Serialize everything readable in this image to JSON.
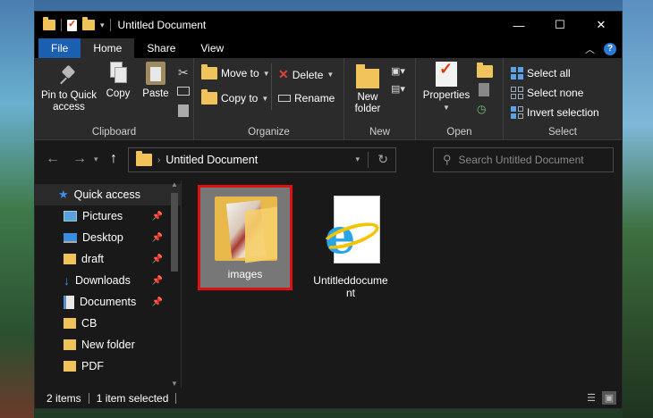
{
  "window": {
    "title": "Untitled Document"
  },
  "controls": {
    "minimize": "—",
    "maximize": "☐",
    "close": "✕"
  },
  "tabs": [
    {
      "label": "File"
    },
    {
      "label": "Home"
    },
    {
      "label": "Share"
    },
    {
      "label": "View"
    }
  ],
  "ribbon": {
    "clipboard": {
      "label": "Clipboard",
      "pin": "Pin to Quick access",
      "copy": "Copy",
      "paste": "Paste"
    },
    "organize": {
      "label": "Organize",
      "move_to": "Move to",
      "copy_to": "Copy to",
      "delete": "Delete",
      "rename": "Rename"
    },
    "new": {
      "label": "New",
      "new_folder": "New folder"
    },
    "open": {
      "label": "Open",
      "properties": "Properties"
    },
    "select": {
      "label": "Select",
      "select_all": "Select all",
      "select_none": "Select none",
      "invert": "Invert selection"
    }
  },
  "address": {
    "path": "Untitled Document",
    "search_placeholder": "Search Untitled Document"
  },
  "sidebar": {
    "items": [
      {
        "label": "Quick access",
        "icon": "star-icon",
        "pinned": false
      },
      {
        "label": "Pictures",
        "icon": "pictures-icon",
        "pinned": true
      },
      {
        "label": "Desktop",
        "icon": "desktop-icon",
        "pinned": true
      },
      {
        "label": "draft",
        "icon": "folder-icon",
        "pinned": true
      },
      {
        "label": "Downloads",
        "icon": "download-icon",
        "pinned": true
      },
      {
        "label": "Documents",
        "icon": "documents-icon",
        "pinned": true
      },
      {
        "label": "CB",
        "icon": "folder-icon",
        "pinned": false
      },
      {
        "label": "New folder",
        "icon": "folder-icon",
        "pinned": false
      },
      {
        "label": "PDF",
        "icon": "folder-icon",
        "pinned": false
      }
    ]
  },
  "files": [
    {
      "name": "images",
      "type": "folder",
      "selected": true
    },
    {
      "name": "Untitleddocument",
      "type": "html-file",
      "selected": false
    }
  ],
  "status": {
    "count": "2 items",
    "selection": "1 item selected"
  }
}
